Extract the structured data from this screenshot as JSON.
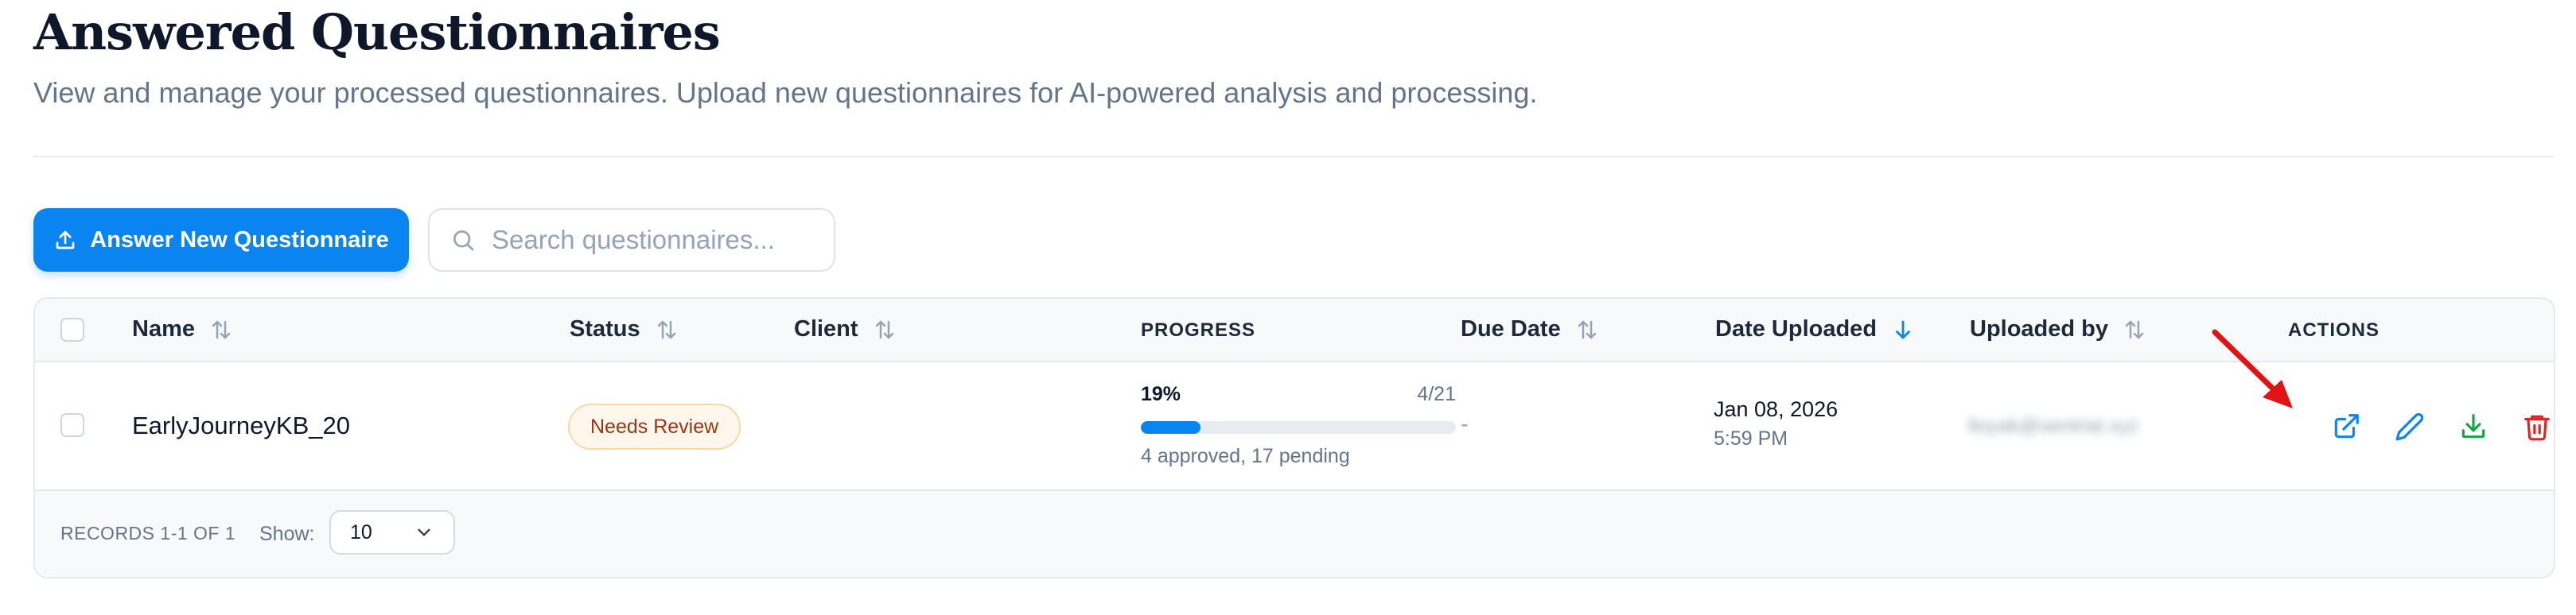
{
  "header": {
    "title": "Answered Questionnaires",
    "subtitle": "View and manage your processed questionnaires. Upload new questionnaires for AI-powered analysis and processing."
  },
  "toolbar": {
    "primary_button_label": "Answer New Questionnaire",
    "search_placeholder": "Search questionnaires..."
  },
  "table": {
    "columns": {
      "name": "Name",
      "status": "Status",
      "client": "Client",
      "progress": "PROGRESS",
      "due_date": "Due Date",
      "date_uploaded": "Date Uploaded",
      "uploaded_by": "Uploaded by",
      "actions": "ACTIONS"
    },
    "sort": {
      "column": "date_uploaded",
      "direction": "descending"
    },
    "rows": [
      {
        "name": "EarlyJourneyKB_20",
        "status": "Needs Review",
        "client": "",
        "progress_percent_label": "19%",
        "progress_fraction": 0.19,
        "progress_count": "4/21",
        "progress_note": "4 approved, 17 pending",
        "due_date": "-",
        "date_uploaded": "Jan 08, 2026",
        "time_uploaded": "5:59 PM",
        "uploaded_by": "lloyak@sentrial.xyz",
        "actions": [
          "open-external-icon",
          "edit-pencil-icon",
          "download-icon",
          "trash-icon"
        ]
      }
    ]
  },
  "footer": {
    "records_label": "RECORDS 1-1 OF 1",
    "show_label": "Show:",
    "page_size": "10"
  },
  "colors": {
    "primary": "#0a84f0",
    "status_badge_bg": "#fff7ec",
    "status_badge_text": "#9a3412",
    "download_action": "#16a34a",
    "delete_action": "#dc2626",
    "annotation_arrow": "#e11414"
  }
}
